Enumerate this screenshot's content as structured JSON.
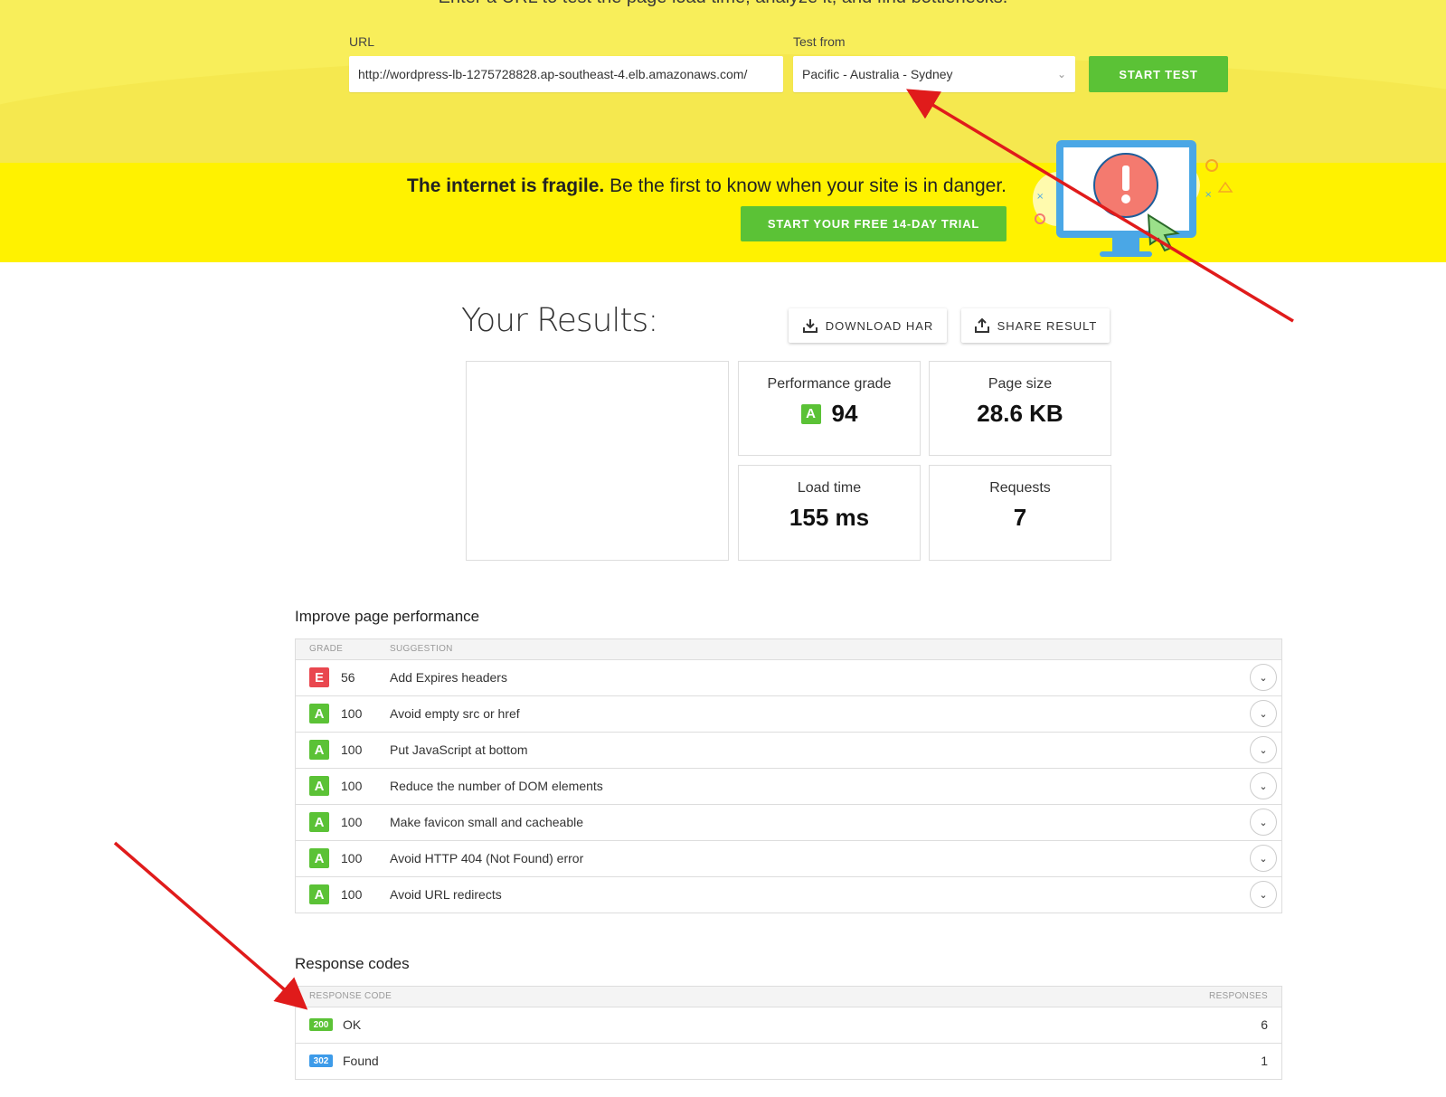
{
  "hero": {
    "tagline": "Enter a URL to test the page load time, analyze it, and find bottlenecks.",
    "url_label": "URL",
    "url_value": "http://wordpress-lb-1275728828.ap-southeast-4.elb.amazonaws.com/",
    "test_from_label": "Test from",
    "test_from_value": "Pacific - Australia - Sydney",
    "start_label": "START TEST"
  },
  "banner": {
    "bold": "The internet is fragile.",
    "text": " Be the first to know when your site is in danger.",
    "trial_label": "START YOUR FREE 14-DAY TRIAL"
  },
  "results": {
    "title": "Your Results:",
    "download_label": "DOWNLOAD HAR",
    "share_label": "SHARE RESULT",
    "perf_label": "Performance grade",
    "perf_grade": "A",
    "perf_score": "94",
    "size_label": "Page size",
    "size_value": "28.6 KB",
    "load_label": "Load time",
    "load_value": "155 ms",
    "req_label": "Requests",
    "req_value": "7"
  },
  "improve": {
    "title": "Improve page performance",
    "col_grade": "GRADE",
    "col_suggestion": "SUGGESTION",
    "rows": [
      {
        "grade": "E",
        "score": "56",
        "suggestion": "Add Expires headers"
      },
      {
        "grade": "A",
        "score": "100",
        "suggestion": "Avoid empty src or href"
      },
      {
        "grade": "A",
        "score": "100",
        "suggestion": "Put JavaScript at bottom"
      },
      {
        "grade": "A",
        "score": "100",
        "suggestion": "Reduce the number of DOM elements"
      },
      {
        "grade": "A",
        "score": "100",
        "suggestion": "Make favicon small and cacheable"
      },
      {
        "grade": "A",
        "score": "100",
        "suggestion": "Avoid HTTP 404 (Not Found) error"
      },
      {
        "grade": "A",
        "score": "100",
        "suggestion": "Avoid URL redirects"
      }
    ]
  },
  "codes": {
    "title": "Response codes",
    "col_code": "RESPONSE CODE",
    "col_responses": "RESPONSES",
    "rows": [
      {
        "code": "200",
        "label": "OK",
        "count": "6"
      },
      {
        "code": "302",
        "label": "Found",
        "count": "1"
      }
    ]
  },
  "colors": {
    "accent_green": "#5bc236",
    "grade_a": "#5bc236",
    "grade_e": "#e9474f",
    "code_200": "#5bc236",
    "code_302": "#3d9be9",
    "banner_yellow": "#fff200",
    "annotation_red": "#e01b1b"
  }
}
